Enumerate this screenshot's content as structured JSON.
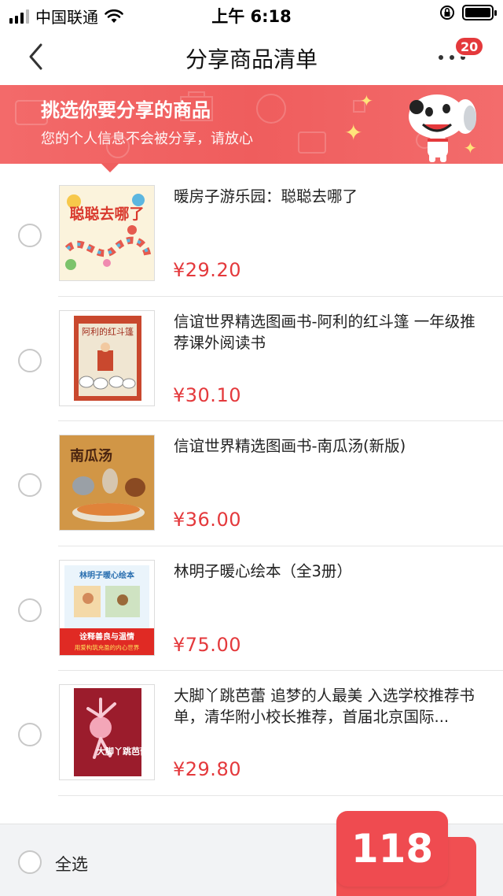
{
  "status_bar": {
    "carrier": "中国联通",
    "time": "上午 6:18"
  },
  "nav": {
    "title": "分享商品清单",
    "badge_count": "20"
  },
  "banner": {
    "title": "挑选你要分享的商品",
    "subtitle": "您的个人信息不会被分享，请放心"
  },
  "products": [
    {
      "title": "暖房子游乐园：聪聪去哪了",
      "price": "¥29.20",
      "cover_text": "聪聪去哪了"
    },
    {
      "title": "信谊世界精选图画书-阿利的红斗篷 一年级推荐课外阅读书",
      "price": "¥30.10",
      "cover_text": "阿利的红斗篷"
    },
    {
      "title": "信谊世界精选图画书-南瓜汤(新版)",
      "price": "¥36.00",
      "cover_text": "南瓜汤"
    },
    {
      "title": "林明子暖心绘本（全3册）",
      "price": "¥75.00",
      "cover_text": "林明子暖心绘本",
      "cover_banner_1": "诠释善良与温情",
      "cover_banner_2": "用爱构筑充盈的内心世界"
    },
    {
      "title": "大脚丫跳芭蕾 追梦的人最美 入选学校推荐书单，清华附小校长推荐，首届北京国际...",
      "price": "¥29.80",
      "cover_text": "大脚丫跳芭蕾"
    }
  ],
  "bottom_bar": {
    "select_all_label": "全选"
  },
  "overlay_count": "118",
  "colors": {
    "accent_red": "#e4393c",
    "banner_red": "#ef5d5d"
  }
}
